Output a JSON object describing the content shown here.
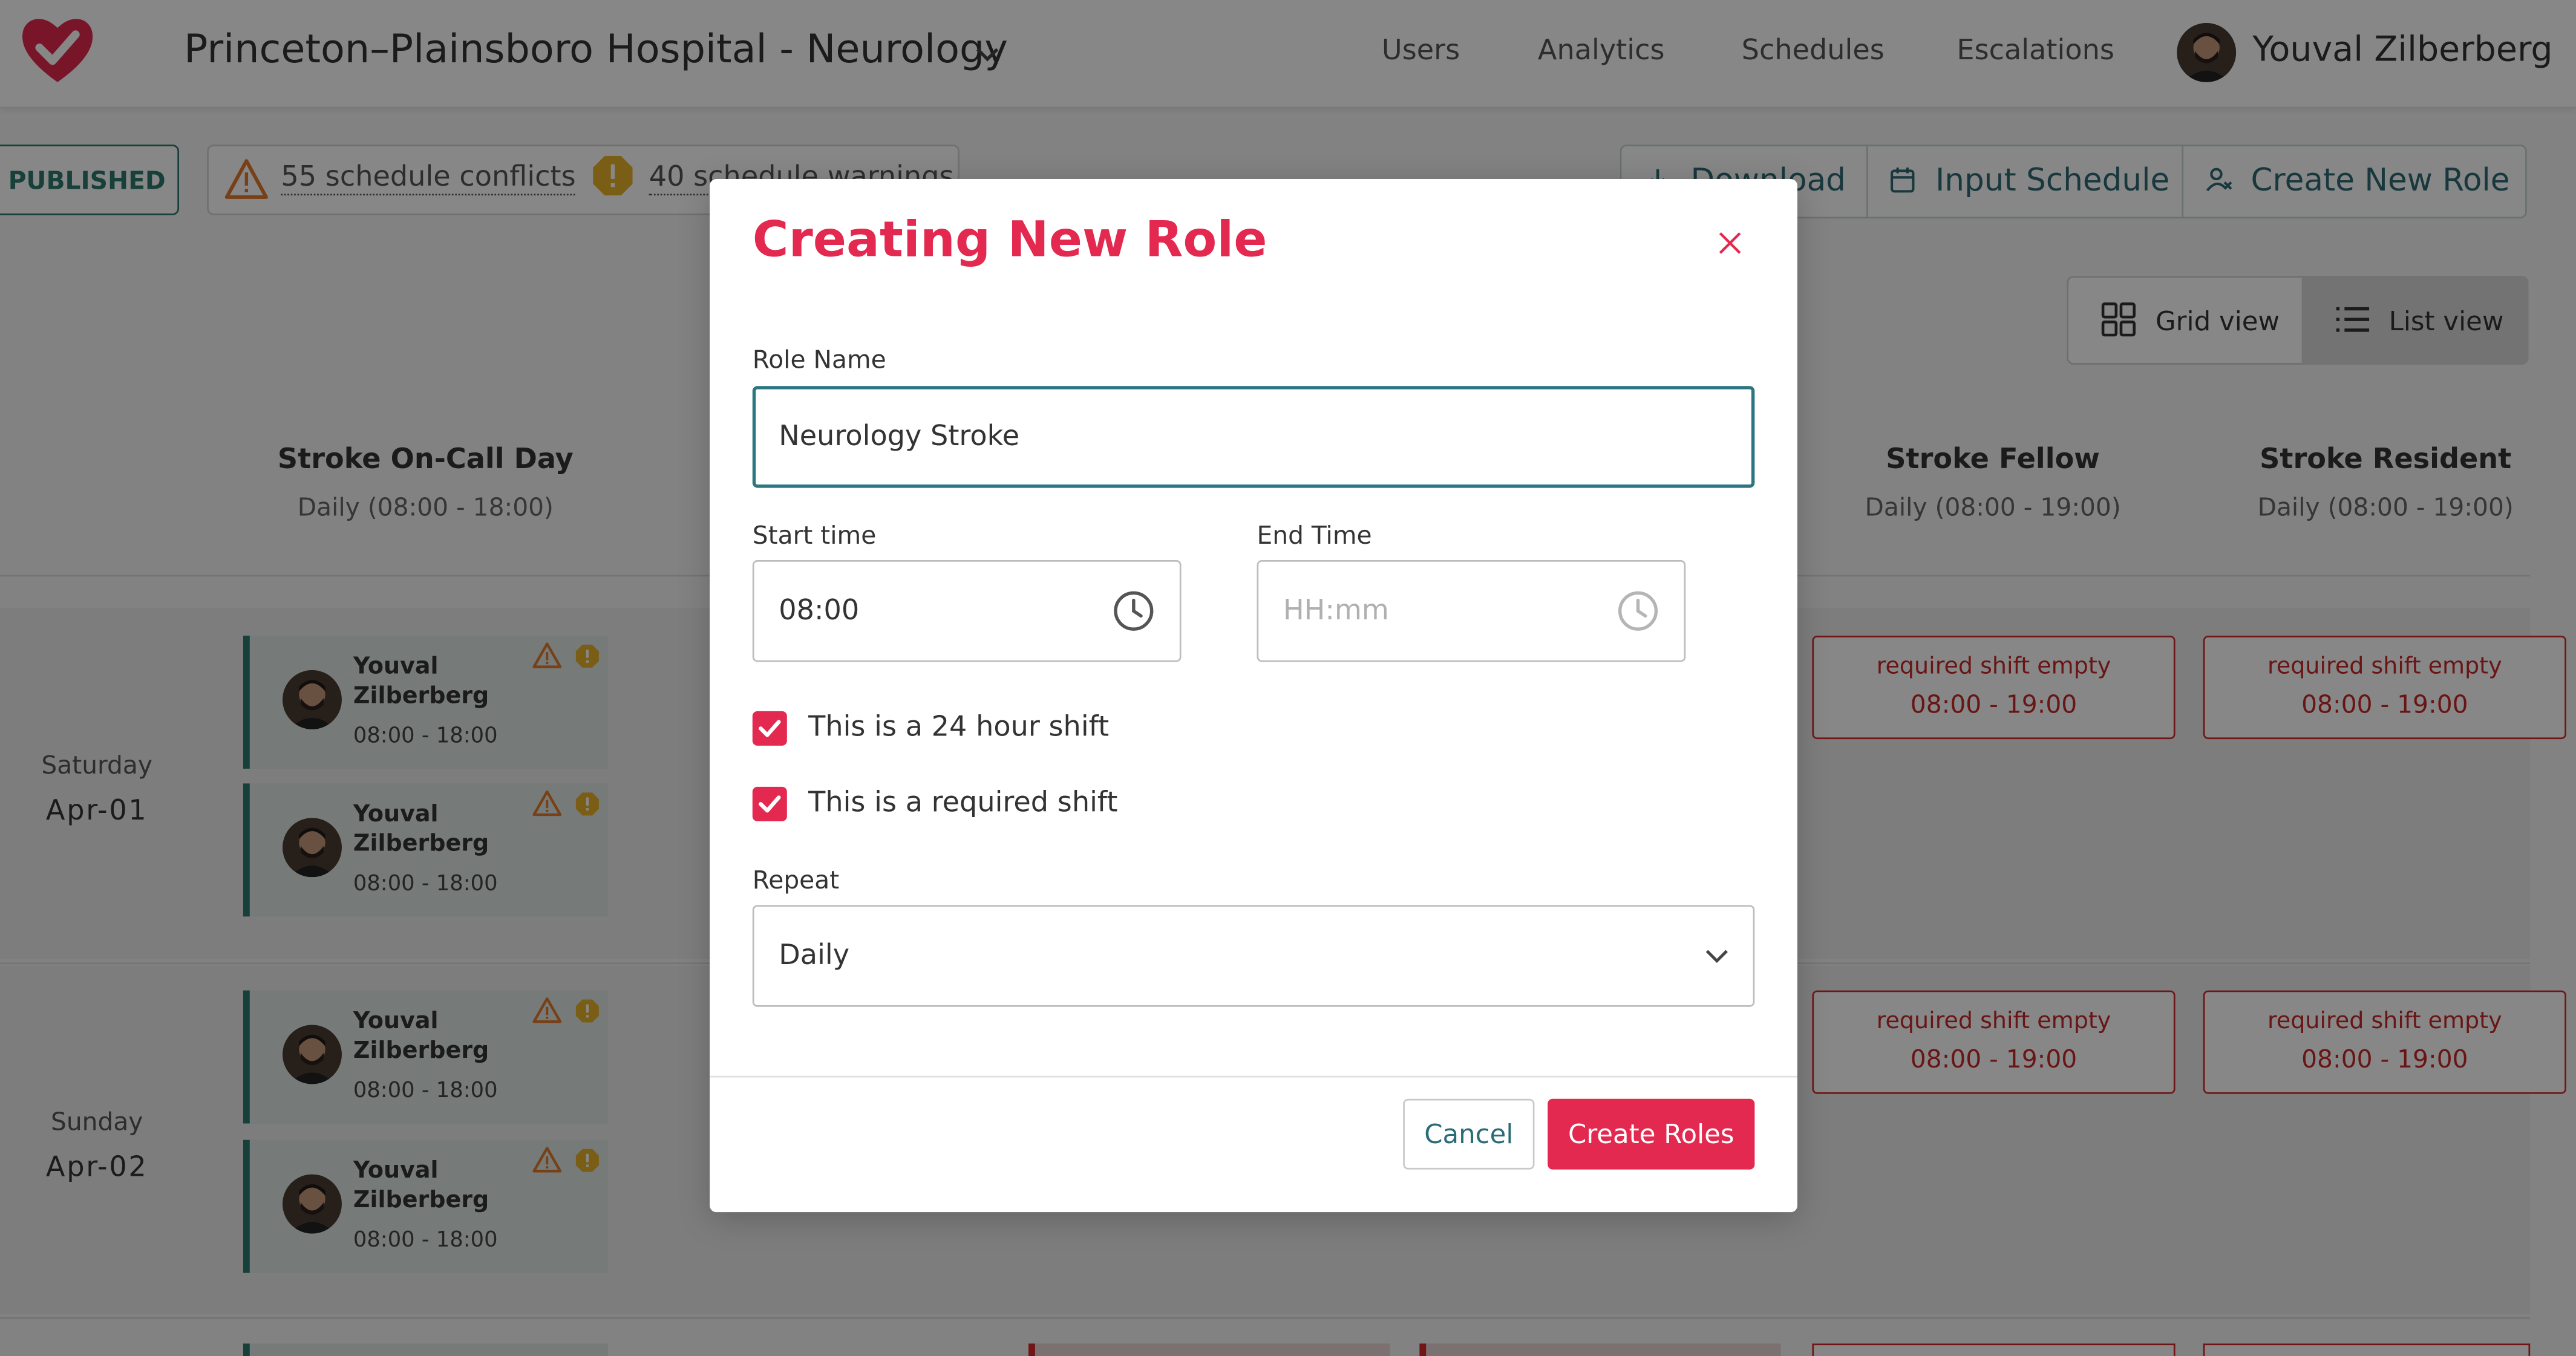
{
  "header": {
    "hospital_name": "Princeton–Plainsboro Hospital - Neurology",
    "nav": [
      "Users",
      "Analytics",
      "Schedules",
      "Escalations"
    ],
    "user_name": "Youval Zilberberg"
  },
  "toolbar": {
    "status_badge": "PUBLISHED",
    "conflicts": "55 schedule conflicts",
    "warnings": "40 schedule warnings",
    "download": "Download",
    "input_schedule": "Input Schedule",
    "create_new_role": "Create New Role"
  },
  "view_toggle": {
    "grid": "Grid view",
    "list": "List view",
    "active": "list"
  },
  "columns": [
    {
      "title": "Stroke On-Call Day",
      "subtitle": "Daily (08:00 - 18:00)"
    },
    {
      "title": "Stroke Fellow",
      "subtitle": "Daily (08:00 - 19:00)"
    },
    {
      "title": "Stroke Resident",
      "subtitle": "Daily (08:00 - 19:00)"
    }
  ],
  "days": [
    {
      "day": "Saturday",
      "date": "Apr-01",
      "shifts": [
        {
          "first": "Youval",
          "last": "Zilberberg",
          "time": "08:00 - 18:00"
        },
        {
          "first": "Youval",
          "last": "Zilberberg",
          "time": "08:00 - 18:00"
        }
      ],
      "required": [
        {
          "label": "required shift empty",
          "time": "08:00 - 19:00"
        },
        {
          "label": "required shift empty",
          "time": "08:00 - 19:00"
        }
      ]
    },
    {
      "day": "Sunday",
      "date": "Apr-02",
      "shifts": [
        {
          "first": "Youval",
          "last": "Zilberberg",
          "time": "08:00 - 18:00"
        },
        {
          "first": "Youval",
          "last": "Zilberberg",
          "time": "08:00 - 18:00"
        }
      ],
      "required": [
        {
          "label": "required shift empty",
          "time": "08:00 - 19:00"
        },
        {
          "label": "required shift empty",
          "time": "08:00 - 19:00"
        }
      ]
    }
  ],
  "modal": {
    "title": "Creating New Role",
    "role_name_label": "Role Name",
    "role_name_value": "Neurology Stroke",
    "start_time_label": "Start time",
    "start_time_value": "08:00",
    "end_time_label": "End Time",
    "end_time_placeholder": "HH:mm",
    "checkbox_24h": "This is a 24 hour shift",
    "checkbox_24h_checked": true,
    "checkbox_required": "This is a required shift",
    "checkbox_required_checked": true,
    "repeat_label": "Repeat",
    "repeat_value": "Daily",
    "cancel_label": "Cancel",
    "create_label": "Create Roles"
  },
  "colors": {
    "brand_red": "#e3294f",
    "teal": "#2e7a6e",
    "link_teal": "#2b6b78",
    "error_red": "#d42a2a",
    "warning_orange": "#e0912b",
    "warning_yellow": "#e7b22b"
  },
  "icons": [
    "heart-check-icon",
    "chevron-down-icon",
    "warning-triangle-icon",
    "warning-octagon-icon",
    "download-icon",
    "calendar-icon",
    "person-add-icon",
    "grid-icon",
    "list-icon",
    "close-icon",
    "clock-icon",
    "checkbox-checked-icon"
  ]
}
